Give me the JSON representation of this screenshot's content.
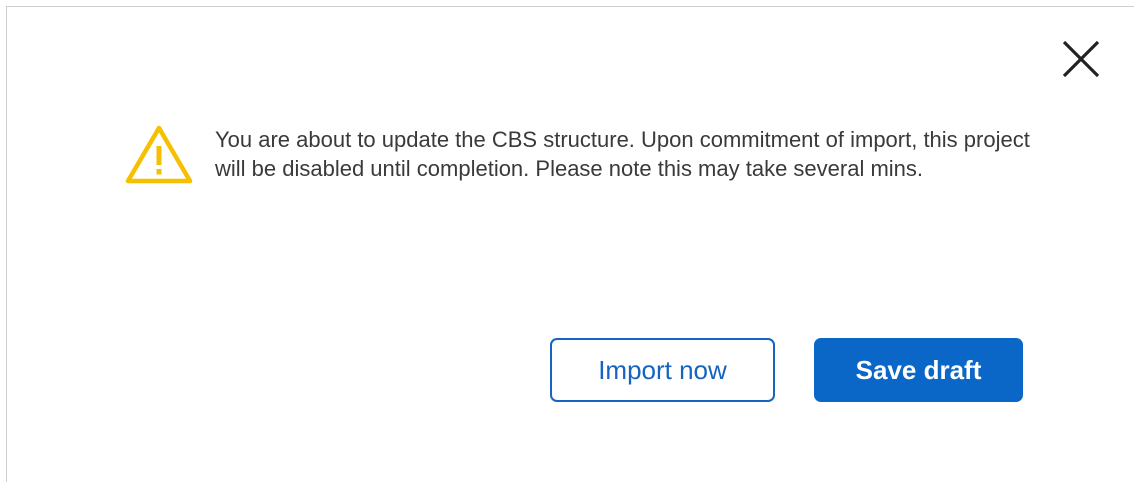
{
  "dialog": {
    "message": "You are about to update the CBS structure. Upon commitment of import, this project will be disabled until completion. Please note this may take several mins.",
    "icons": {
      "warning": "warning-triangle-icon",
      "close": "close-icon"
    },
    "buttons": {
      "import_label": "Import now",
      "save_label": "Save draft"
    },
    "colors": {
      "warning": "#F5C000",
      "primary": "#0A66C7",
      "secondary_border": "#1565C0",
      "text": "#3A3A3A"
    }
  }
}
